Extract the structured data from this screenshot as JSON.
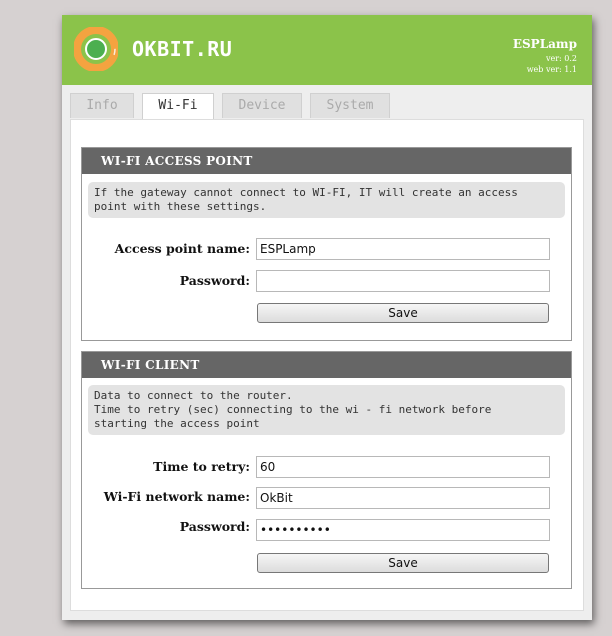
{
  "header": {
    "brand": "OKBIT.RU",
    "app_name": "ESPLamp",
    "version": "ver: 0.2",
    "web_version": "web ver: 1.1",
    "colors": {
      "header_bg": "#8bc34a",
      "logo_ring": "#f4a340",
      "logo_center": "#4caf50"
    }
  },
  "tabs": [
    {
      "label": "Info"
    },
    {
      "label": "Wi-Fi",
      "active": true
    },
    {
      "label": "Device"
    },
    {
      "label": "System"
    }
  ],
  "access_point": {
    "title": "WI-FI ACCESS POINT",
    "note": "If the gateway cannot connect to WI-FI, IT will create an access\npoint with these settings.",
    "name_label": "Access point name:",
    "name_value": "ESPLamp",
    "password_label": "Password:",
    "password_value": "",
    "save_label": "Save"
  },
  "client": {
    "title": "WI-FI CLIENT",
    "note": "Data to connect to the router.\nTime to retry (sec) connecting to the wi - fi network before\nstarting the access point",
    "retry_label": "Time to retry:",
    "retry_value": "60",
    "network_label": "Wi-Fi network name:",
    "network_value": "OkBit",
    "password_label": "Password:",
    "password_value": "0123456789",
    "save_label": "Save"
  }
}
